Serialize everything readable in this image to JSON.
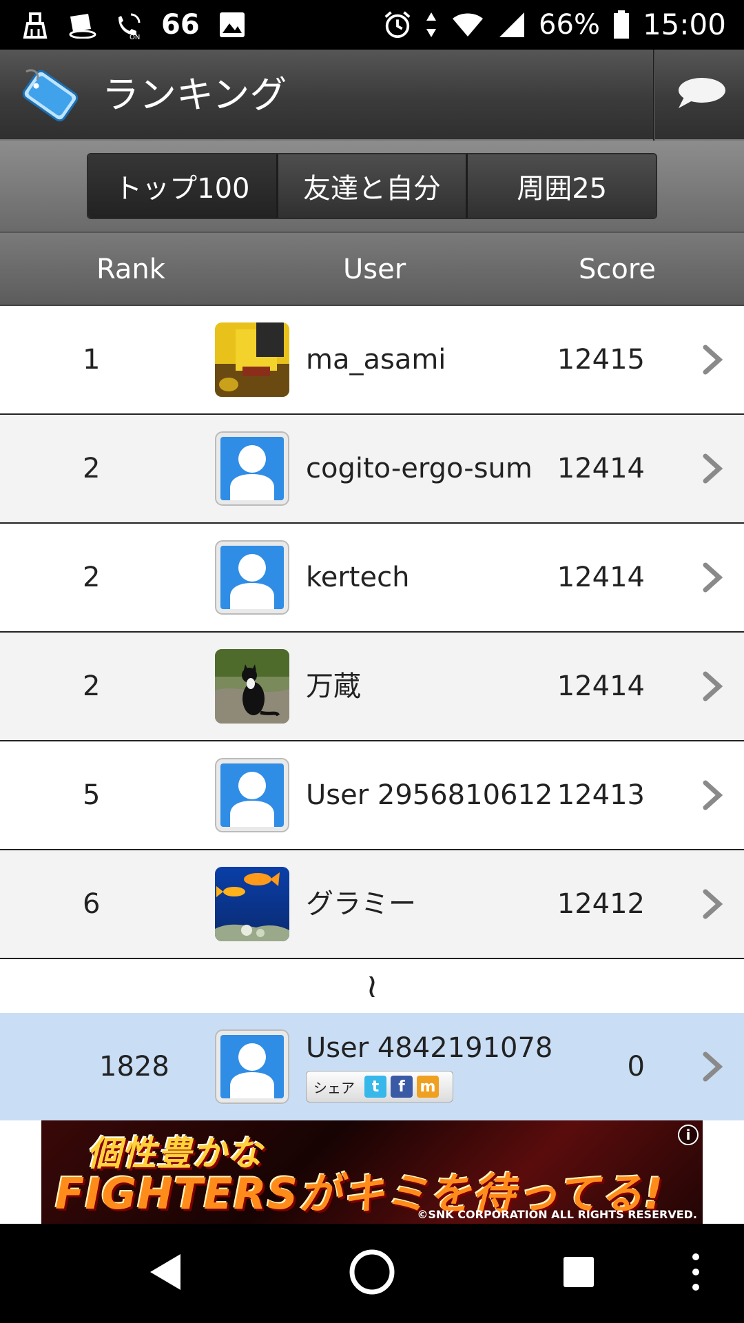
{
  "status_bar": {
    "notification_count": "66",
    "battery": "66%",
    "time": "15:00"
  },
  "titlebar": {
    "title": "ランキング"
  },
  "tabs": [
    {
      "label": "トップ100",
      "active": true
    },
    {
      "label": "友達と自分",
      "active": false
    },
    {
      "label": "周囲25",
      "active": false
    }
  ],
  "columns": {
    "rank": "Rank",
    "user": "User",
    "score": "Score"
  },
  "rows": [
    {
      "rank": "1",
      "user": "ma_asami",
      "score": "12415",
      "avatar": "photo-yellow"
    },
    {
      "rank": "2",
      "user": "cogito-ergo-sum",
      "score": "12414",
      "avatar": "default-user"
    },
    {
      "rank": "2",
      "user": "kertech",
      "score": "12414",
      "avatar": "default-user"
    },
    {
      "rank": "2",
      "user": "万蔵",
      "score": "12414",
      "avatar": "photo-cat"
    },
    {
      "rank": "5",
      "user": "User 2956810612",
      "score": "12413",
      "avatar": "default-user"
    },
    {
      "rank": "6",
      "user": "グラミー",
      "score": "12412",
      "avatar": "photo-fish"
    }
  ],
  "ellipsis_glyph": "≀",
  "self_row": {
    "rank": "1828",
    "user": "User 4842191078",
    "score": "0",
    "share_label": "シェア"
  },
  "ad": {
    "line1": "個性豊かな",
    "line2": "FIGHTERSがキミを待ってる!",
    "copyright": "©SNK CORPORATION ALL RIGHTS RESERVED.",
    "info": "i"
  },
  "colors": {
    "self_highlight": "#c9def5",
    "default_avatar_blue": "#2f8de6"
  }
}
